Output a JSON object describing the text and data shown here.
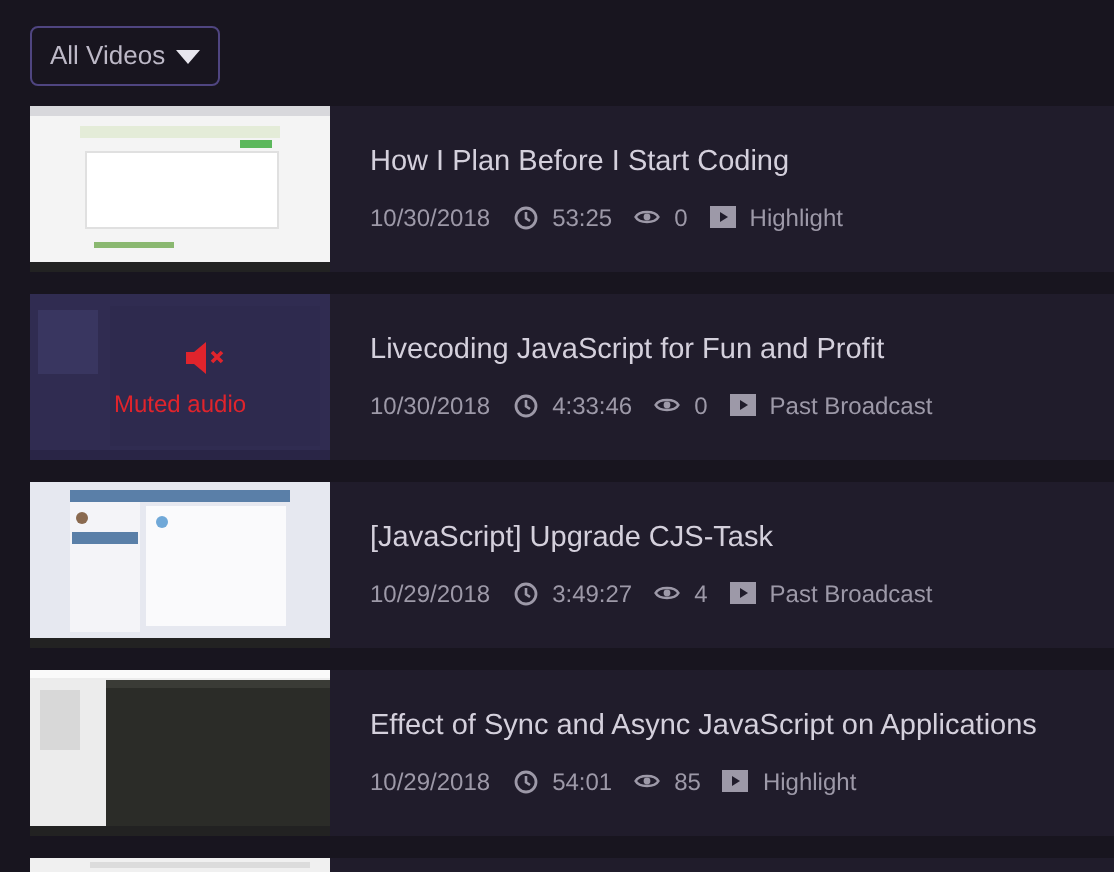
{
  "filter": {
    "label": "All Videos"
  },
  "videos": [
    {
      "title": "How I Plan Before I Start Coding",
      "date": "10/30/2018",
      "duration": "53:25",
      "views": "0",
      "type": "Highlight",
      "muted": false
    },
    {
      "title": "Livecoding JavaScript for Fun and Profit",
      "date": "10/30/2018",
      "duration": "4:33:46",
      "views": "0",
      "type": "Past Broadcast",
      "muted": true,
      "muted_label": "Muted audio"
    },
    {
      "title": "[JavaScript] Upgrade CJS-Task",
      "date": "10/29/2018",
      "duration": "3:49:27",
      "views": "4",
      "type": "Past Broadcast",
      "muted": false
    },
    {
      "title": "Effect of Sync and Async JavaScript on Applications",
      "date": "10/29/2018",
      "duration": "54:01",
      "views": "85",
      "type": "Highlight",
      "muted": false
    }
  ],
  "more_below": true
}
